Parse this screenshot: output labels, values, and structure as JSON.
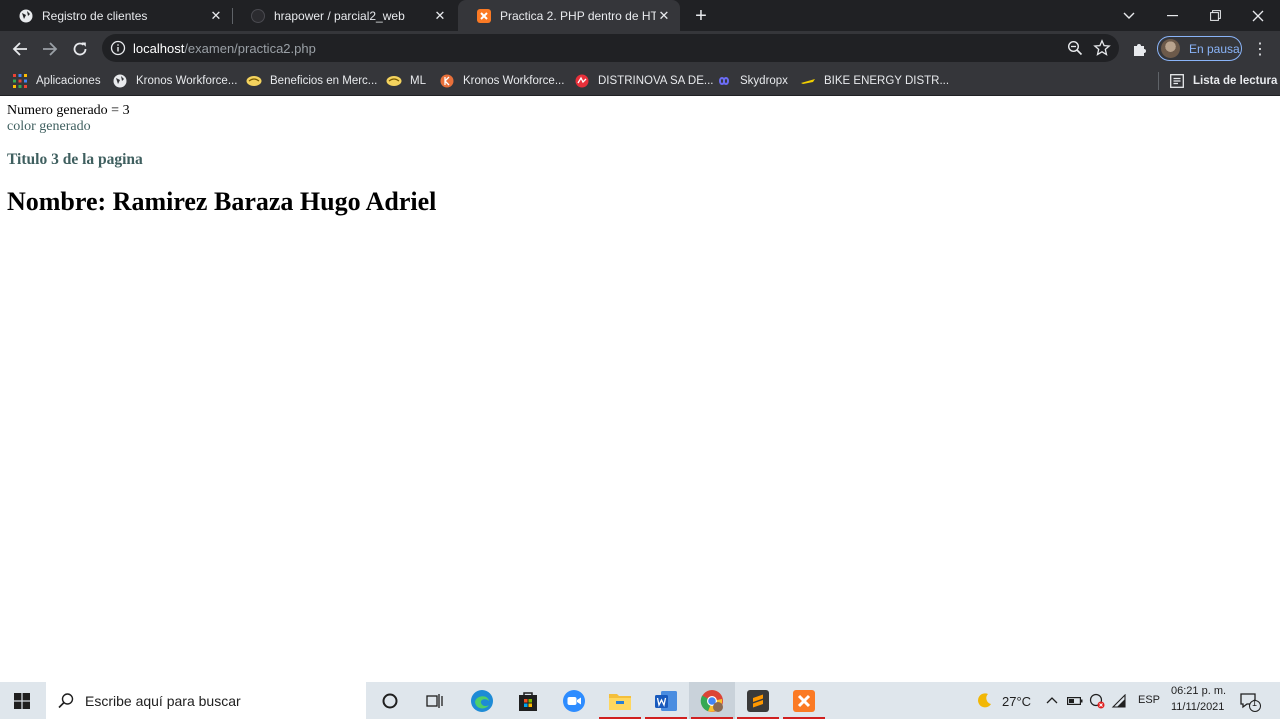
{
  "browser": {
    "tabs": [
      {
        "title": "Registro de clientes",
        "icon": "globe-icon"
      },
      {
        "title": "hrapower / parcial2_web",
        "icon": "github-icon"
      },
      {
        "title": "Practica 2. PHP dentro de HTML",
        "icon": "xampp-icon"
      }
    ],
    "address": {
      "host": "localhost",
      "path": "/examen/practica2.php"
    },
    "profile_label": "En pausa",
    "bookmarks": [
      {
        "label": "Aplicaciones",
        "icon": "apps-grid-icon"
      },
      {
        "label": "Kronos Workforce...",
        "icon": "globe-icon"
      },
      {
        "label": "Beneficios en Merc...",
        "icon": "handshake-icon"
      },
      {
        "label": "ML",
        "icon": "handshake-icon"
      },
      {
        "label": "Kronos Workforce...",
        "icon": "kronos-icon"
      },
      {
        "label": "DISTRINOVA SA DE...",
        "icon": "distrinova-icon"
      },
      {
        "label": "Skydropx",
        "icon": "skydropx-icon"
      },
      {
        "label": "BIKE ENERGY DISTR...",
        "icon": "bike-energy-icon"
      }
    ],
    "reading_list_label": "Lista de lectura"
  },
  "page": {
    "numero": "Numero generado = 3",
    "color_generado": "color generado",
    "titulo": "Titulo 3 de la pagina",
    "nombre": "Nombre: Ramirez Baraza Hugo Adriel"
  },
  "taskbar": {
    "search_placeholder": "Escribe aquí para buscar",
    "temperature": "27°C",
    "language": "ESP",
    "time": "06:21 p. m.",
    "date": "11/11/2021",
    "notification_count": "1"
  },
  "colors": {
    "chrome_dark": "#202124",
    "chrome_toolbar": "#35363a",
    "heading_color": "#3f5f5f",
    "accent_blue": "#8ab4f8",
    "taskbar": "#dfe6ec"
  }
}
